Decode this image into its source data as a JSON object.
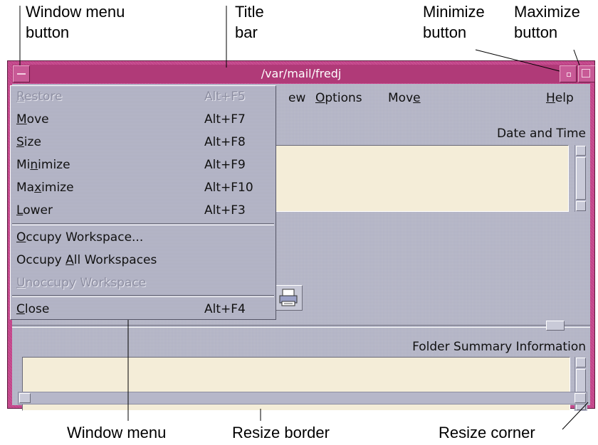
{
  "callouts": {
    "window_menu_button": "Window menu\nbutton",
    "title_bar": "Title\nbar",
    "minimize_button": "Minimize\nbutton",
    "maximize_button": "Maximize\nbutton",
    "window_menu": "Window menu",
    "resize_border": "Resize border",
    "resize_corner": "Resize corner"
  },
  "window": {
    "title": "/var/mail/fredj",
    "menubar": [
      {
        "pre": "",
        "mn": "",
        "post": "ew"
      },
      {
        "pre": "",
        "mn": "O",
        "post": "ptions"
      },
      {
        "pre": "Mov",
        "mn": "e",
        "post": ""
      },
      {
        "pre": "",
        "mn": "H",
        "post": "elp"
      }
    ],
    "header_date": "Date and Time",
    "header_folder": "Folder Summary Information"
  },
  "window_menu": {
    "items": [
      {
        "pre": "",
        "mn": "R",
        "post": "estore",
        "acc": "Alt+F5",
        "disabled": true
      },
      {
        "pre": "",
        "mn": "M",
        "post": "ove",
        "acc": "Alt+F7",
        "disabled": false
      },
      {
        "pre": "",
        "mn": "S",
        "post": "ize",
        "acc": "Alt+F8",
        "disabled": false
      },
      {
        "pre": "Mi",
        "mn": "n",
        "post": "imize",
        "acc": "Alt+F9",
        "disabled": false
      },
      {
        "pre": "Ma",
        "mn": "x",
        "post": "imize",
        "acc": "Alt+F10",
        "disabled": false
      },
      {
        "pre": "",
        "mn": "L",
        "post": "ower",
        "acc": "Alt+F3",
        "disabled": false
      },
      {
        "pre": "",
        "mn": "O",
        "post": "ccupy Workspace...",
        "acc": "",
        "disabled": false
      },
      {
        "pre": "Occupy ",
        "mn": "A",
        "post": "ll Workspaces",
        "acc": "",
        "disabled": false
      },
      {
        "pre": "",
        "mn": "U",
        "post": "noccupy Workspace",
        "acc": "",
        "disabled": true
      },
      {
        "pre": "",
        "mn": "C",
        "post": "lose",
        "acc": "Alt+F4",
        "disabled": false
      }
    ]
  },
  "colors": {
    "frame": "#c3458a",
    "title_bar": "#b03a78",
    "client_bg": "#b6b7c9",
    "list_bg": "#f4edd8"
  },
  "icons": {
    "window_menu_button": "dash-icon",
    "minimize_button": "dot-square-icon",
    "maximize_button": "square-icon",
    "print": "printer-icon"
  }
}
